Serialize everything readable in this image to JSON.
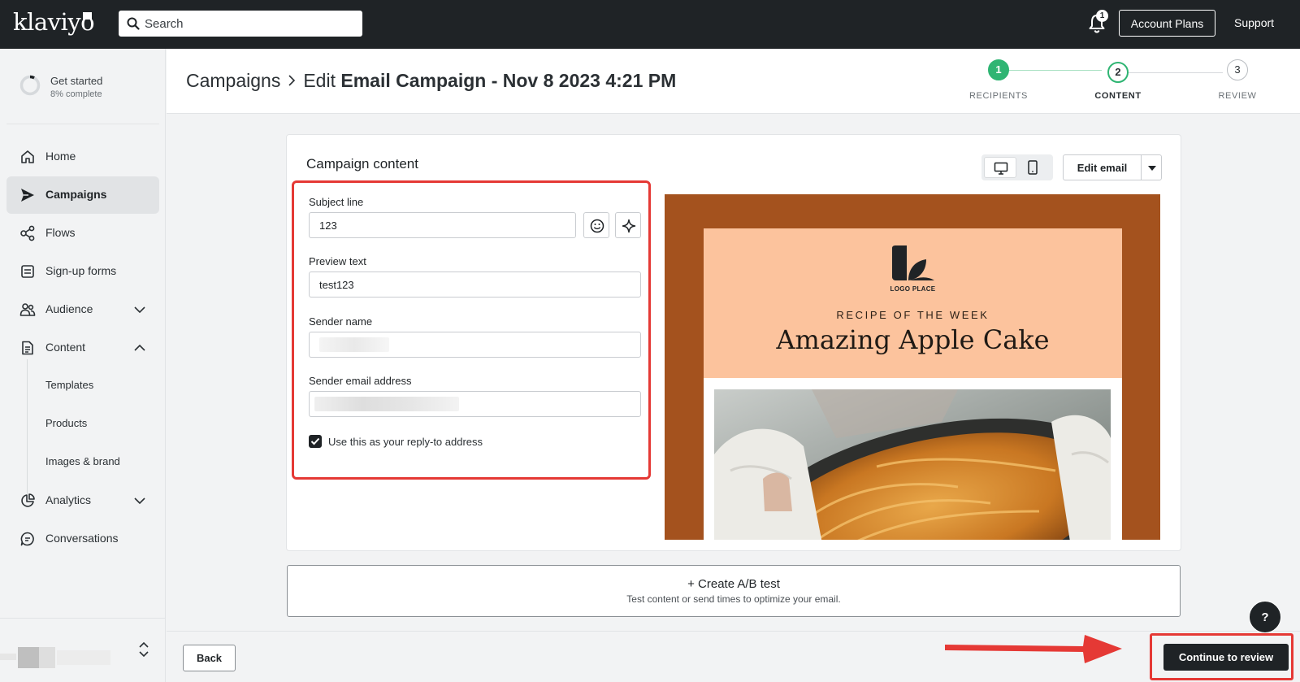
{
  "topbar": {
    "logo": "klaviyo",
    "search_placeholder": "Search",
    "notification_count": "1",
    "account_plans": "Account Plans",
    "support": "Support"
  },
  "sidebar": {
    "get_started": {
      "title": "Get started",
      "progress": "8% complete",
      "progress_fraction": 0.08
    },
    "items": [
      {
        "label": "Home",
        "icon": "home-icon"
      },
      {
        "label": "Campaigns",
        "icon": "send-icon",
        "active": true
      },
      {
        "label": "Flows",
        "icon": "flows-icon"
      },
      {
        "label": "Sign-up forms",
        "icon": "form-icon"
      },
      {
        "label": "Audience",
        "icon": "audience-icon",
        "expanded": false
      },
      {
        "label": "Content",
        "icon": "content-icon",
        "expanded": true
      }
    ],
    "content_subitems": [
      {
        "label": "Templates"
      },
      {
        "label": "Products"
      },
      {
        "label": "Images & brand"
      }
    ],
    "items_after": [
      {
        "label": "Analytics",
        "icon": "analytics-icon",
        "expanded": false
      },
      {
        "label": "Conversations",
        "icon": "chat-icon"
      }
    ]
  },
  "header": {
    "breadcrumb_root": "Campaigns",
    "breadcrumb_prefix": "Edit",
    "breadcrumb_title": "Email Campaign - Nov 8 2023 4:21 PM",
    "steps": [
      {
        "number": "1",
        "label": "RECIPIENTS",
        "status": "complete"
      },
      {
        "number": "2",
        "label": "CONTENT",
        "status": "current"
      },
      {
        "number": "3",
        "label": "REVIEW",
        "status": "upcoming"
      }
    ]
  },
  "content_card": {
    "title": "Campaign content",
    "subject_label": "Subject line",
    "subject_value": "123",
    "preview_label": "Preview text",
    "preview_value": "test123",
    "sender_name_label": "Sender name",
    "sender_email_label": "Sender email address",
    "reply_to_label": "Use this as your reply-to address",
    "reply_to_checked": true,
    "edit_email": "Edit email"
  },
  "email_preview": {
    "logo_text": "LOGO PLACE",
    "kicker": "RECIPE OF THE WEEK",
    "headline": "Amazing Apple Cake",
    "outer_color": "#a4521e",
    "banner_color": "#fcc39d"
  },
  "ab_test": {
    "title": "+ Create A/B test",
    "subtitle": "Test content or send times to optimize your email."
  },
  "footer": {
    "back": "Back",
    "continue": "Continue to review"
  },
  "help": "?",
  "colors": {
    "accent_green": "#2fb573",
    "annotation_red": "#e53935",
    "dark": "#1f2326"
  }
}
